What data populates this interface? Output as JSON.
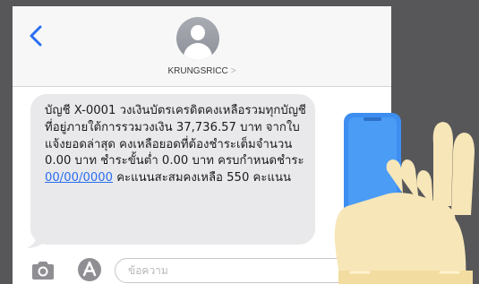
{
  "header": {
    "back_label": "<",
    "contact_name": "KRUNGSRICC",
    "contact_chevron": ">"
  },
  "message": {
    "text_before_link": "บัญชี  X-0001 วงเงินบัตรเครดิตคงเหลือรวมทุกบัญชีที่อยู่ภายใต้การรวมวงเงิน 37,736.57 บาท จากใบแจ้งยอดล่าสุด คงเหลือยอดที่ต้องชำระเต็มจำนวน 0.00 บาท ชำระขั้นต่ำ 0.00 บาท ครบกำหนดชำระ ",
    "link_text": "00/00/0000",
    "text_after_link": " คะแนนสะสมคงเหลือ 550 คะแนน"
  },
  "compose": {
    "placeholder": "ข้อความ"
  },
  "icons": {
    "back": "chevron-left-icon",
    "avatar": "person-avatar-icon",
    "camera": "camera-icon",
    "appstore": "app-store-icon"
  },
  "colors": {
    "accent": "#2a6ef0",
    "bubble": "#e9e9eb",
    "backdrop": "#57575a",
    "phone_body": "#3d8ef0",
    "skin": "#f7e6b8"
  }
}
